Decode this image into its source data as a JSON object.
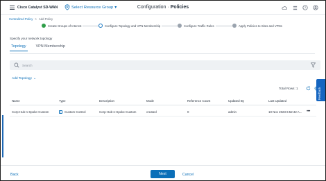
{
  "header": {
    "app_title": "Cisco Catalyst SD-WAN",
    "location_label": "Select Resource Group",
    "page_title_prefix": "Configuration",
    "page_title_separator": "·",
    "page_title_section": "Policies",
    "icons": [
      "cloud-icon",
      "list-icon",
      "help-icon",
      "user-icon"
    ]
  },
  "breadcrumb": {
    "parent": "Centralized Policy",
    "separator": ">",
    "current": "Add Policy"
  },
  "stepper": {
    "steps": [
      {
        "label": "Create Groups of Interest",
        "state": "done"
      },
      {
        "label": "Configure Topology and VPN Membership",
        "state": "current"
      },
      {
        "label": "Configure Traffic Rules",
        "state": "todo"
      },
      {
        "label": "Apply Policies to Sites and VPNs",
        "state": "todo"
      }
    ]
  },
  "subtitle": "Specify your network topology",
  "tabs": [
    {
      "label": "Topology",
      "active": true
    },
    {
      "label": "VPN Membership",
      "active": false
    }
  ],
  "search": {
    "placeholder": "Search",
    "value": ""
  },
  "add_topology_label": "Add Topology",
  "table": {
    "total_rows_label": "Total Rows: 1",
    "columns": [
      "Name",
      "Type",
      "Description",
      "Mode",
      "Reference Count",
      "Updated By",
      "Last Updated"
    ],
    "rows": [
      {
        "name": "Corp-Hub-n-Spoke-Custom",
        "type": "Custom Control",
        "description": "Corp-Hub-n-Spoke-Custom",
        "mode": "created",
        "reference_count": "0",
        "updated_by": "admin",
        "last_updated": "10 Nov 2023 6:52:42 A..."
      }
    ],
    "row_menu": "•••"
  },
  "feedback_label": "Feedback",
  "footer": {
    "back_label": "Back",
    "next_label": "Next",
    "cancel_label": "Cancel"
  },
  "colors": {
    "accent": "#0b6fb8",
    "done": "#2e9e48",
    "pending": "#9aa3ae",
    "feedback": "#1565c0"
  }
}
